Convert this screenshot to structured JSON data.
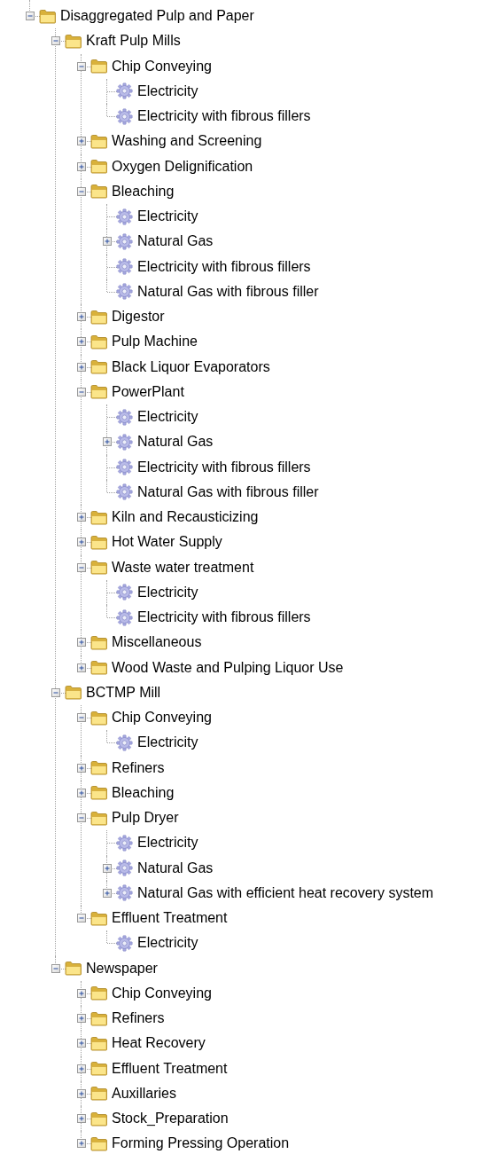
{
  "tree": [
    {
      "label": "Disaggregated Pulp and Paper",
      "kind": "folder",
      "expanded": true,
      "children": [
        {
          "label": "Kraft Pulp Mills",
          "kind": "folder",
          "expanded": true,
          "children": [
            {
              "label": "Chip Conveying",
              "kind": "folder",
              "expanded": true,
              "children": [
                {
                  "label": "Electricity",
                  "kind": "gear"
                },
                {
                  "label": "Electricity with fibrous fillers",
                  "kind": "gear"
                }
              ]
            },
            {
              "label": "Washing and Screening",
              "kind": "folder",
              "expanded": false
            },
            {
              "label": "Oxygen Delignification",
              "kind": "folder",
              "expanded": false
            },
            {
              "label": "Bleaching",
              "kind": "folder",
              "expanded": true,
              "children": [
                {
                  "label": "Electricity",
                  "kind": "gear"
                },
                {
                  "label": "Natural Gas",
                  "kind": "gear",
                  "expanded": false
                },
                {
                  "label": "Electricity with fibrous fillers",
                  "kind": "gear"
                },
                {
                  "label": "Natural Gas with fibrous filler",
                  "kind": "gear"
                }
              ]
            },
            {
              "label": "Digestor",
              "kind": "folder",
              "expanded": false
            },
            {
              "label": "Pulp Machine",
              "kind": "folder",
              "expanded": false
            },
            {
              "label": "Black Liquor Evaporators",
              "kind": "folder",
              "expanded": false
            },
            {
              "label": "PowerPlant",
              "kind": "folder",
              "expanded": true,
              "children": [
                {
                  "label": "Electricity",
                  "kind": "gear"
                },
                {
                  "label": "Natural Gas",
                  "kind": "gear",
                  "expanded": false
                },
                {
                  "label": "Electricity with fibrous fillers",
                  "kind": "gear"
                },
                {
                  "label": "Natural Gas with fibrous filler",
                  "kind": "gear"
                }
              ]
            },
            {
              "label": "Kiln and Recausticizing",
              "kind": "folder",
              "expanded": false
            },
            {
              "label": "Hot Water Supply",
              "kind": "folder",
              "expanded": false
            },
            {
              "label": "Waste water treatment",
              "kind": "folder",
              "expanded": true,
              "children": [
                {
                  "label": "Electricity",
                  "kind": "gear"
                },
                {
                  "label": "Electricity with fibrous fillers",
                  "kind": "gear"
                }
              ]
            },
            {
              "label": "Miscellaneous",
              "kind": "folder",
              "expanded": false
            },
            {
              "label": "Wood Waste and Pulping Liquor Use",
              "kind": "folder",
              "expanded": false
            }
          ]
        },
        {
          "label": "BCTMP Mill",
          "kind": "folder",
          "expanded": true,
          "children": [
            {
              "label": "Chip Conveying",
              "kind": "folder",
              "expanded": true,
              "children": [
                {
                  "label": "Electricity",
                  "kind": "gear"
                }
              ]
            },
            {
              "label": "Refiners",
              "kind": "folder",
              "expanded": false
            },
            {
              "label": "Bleaching",
              "kind": "folder",
              "expanded": false
            },
            {
              "label": "Pulp Dryer",
              "kind": "folder",
              "expanded": true,
              "children": [
                {
                  "label": "Electricity",
                  "kind": "gear"
                },
                {
                  "label": "Natural Gas",
                  "kind": "gear",
                  "expanded": false
                },
                {
                  "label": "Natural Gas with efficient heat recovery system",
                  "kind": "gear",
                  "expanded": false
                }
              ]
            },
            {
              "label": "Effluent Treatment",
              "kind": "folder",
              "expanded": true,
              "children": [
                {
                  "label": "Electricity",
                  "kind": "gear"
                }
              ]
            }
          ]
        },
        {
          "label": "Newspaper",
          "kind": "folder",
          "expanded": true,
          "children": [
            {
              "label": "Chip Conveying",
              "kind": "folder",
              "expanded": false
            },
            {
              "label": "Refiners",
              "kind": "folder",
              "expanded": false
            },
            {
              "label": "Heat Recovery",
              "kind": "folder",
              "expanded": false
            },
            {
              "label": "Effluent Treatment",
              "kind": "folder",
              "expanded": false
            },
            {
              "label": "Auxillaries",
              "kind": "folder",
              "expanded": false
            },
            {
              "label": "Stock_Preparation",
              "kind": "folder",
              "expanded": false
            },
            {
              "label": "Forming Pressing Operation",
              "kind": "folder",
              "expanded": false
            }
          ]
        }
      ]
    }
  ]
}
